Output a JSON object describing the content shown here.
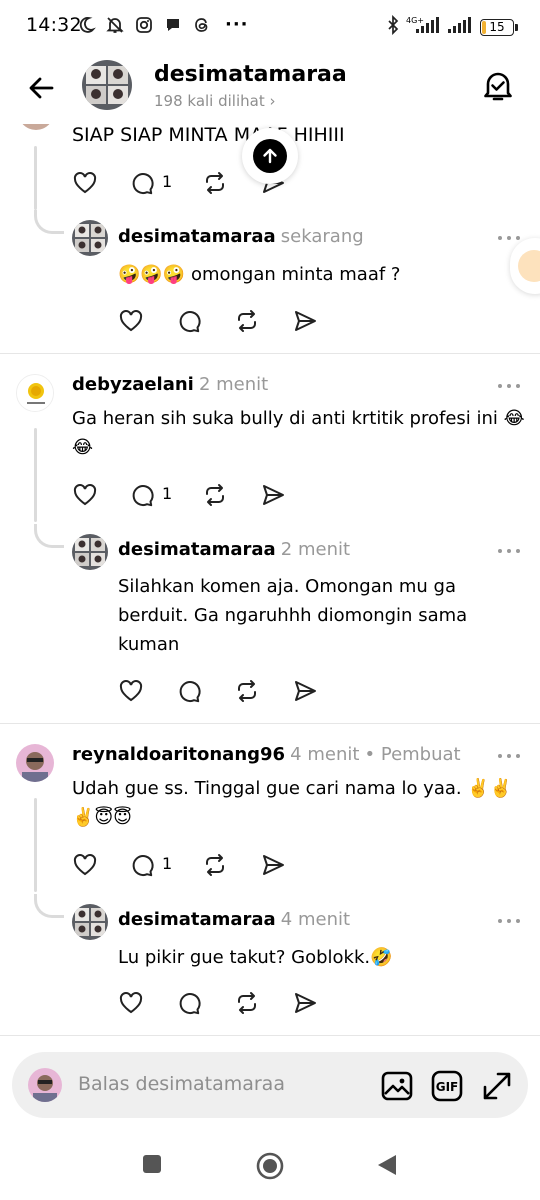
{
  "status_bar": {
    "time": "14:32",
    "network": "4G+",
    "battery": "15",
    "battery_fraction": 0.15
  },
  "header": {
    "username": "desimatamaraa",
    "views": "198 kali dilihat",
    "views_chevron": "›"
  },
  "thread": {
    "top_partial_text": "SIAP SIAP MINTA MAAF HIHIII",
    "top_reply_count": "1",
    "comments": [
      {
        "reply": {
          "username": "desimatamaraa",
          "time": "sekarang",
          "text": "🤪🤪🤪 omongan minta maaf ?"
        }
      },
      {
        "username": "debyzaelani",
        "time": "2 menit",
        "text": "Ga heran sih suka bully di anti krtitik profesi ini 😂",
        "text_line2": "😂",
        "reply_count": "1",
        "reply": {
          "username": "desimatamaraa",
          "time": "2 menit",
          "text": "Silahkan komen aja. Omongan mu ga",
          "text_line2": "berduit. Ga ngaruhhh diomongin sama",
          "text_line3": "kuman"
        }
      },
      {
        "username": "reynaldoaritonang96",
        "time": "4 menit",
        "creator_badge": "• Pembuat",
        "text": "Udah gue ss. Tinggal gue cari nama lo yaa. ✌️✌️",
        "text_line2": "✌️😇😇",
        "reply_count": "1",
        "reply": {
          "username": "desimatamaraa",
          "time": "4 menit",
          "text": "Lu pikir gue takut? Goblokk.🤣"
        }
      }
    ]
  },
  "reply_bar": {
    "placeholder": "Balas desimatamaraa",
    "gif_label": "GIF"
  },
  "icons": {
    "like": "heart-icon",
    "comment": "comment-icon",
    "repost": "repost-icon",
    "share": "send-icon",
    "more": "more-dots-icon"
  },
  "colors": {
    "muted_text": "#999999",
    "thread_line": "#dbdbdb",
    "battery": "#f2b233"
  }
}
